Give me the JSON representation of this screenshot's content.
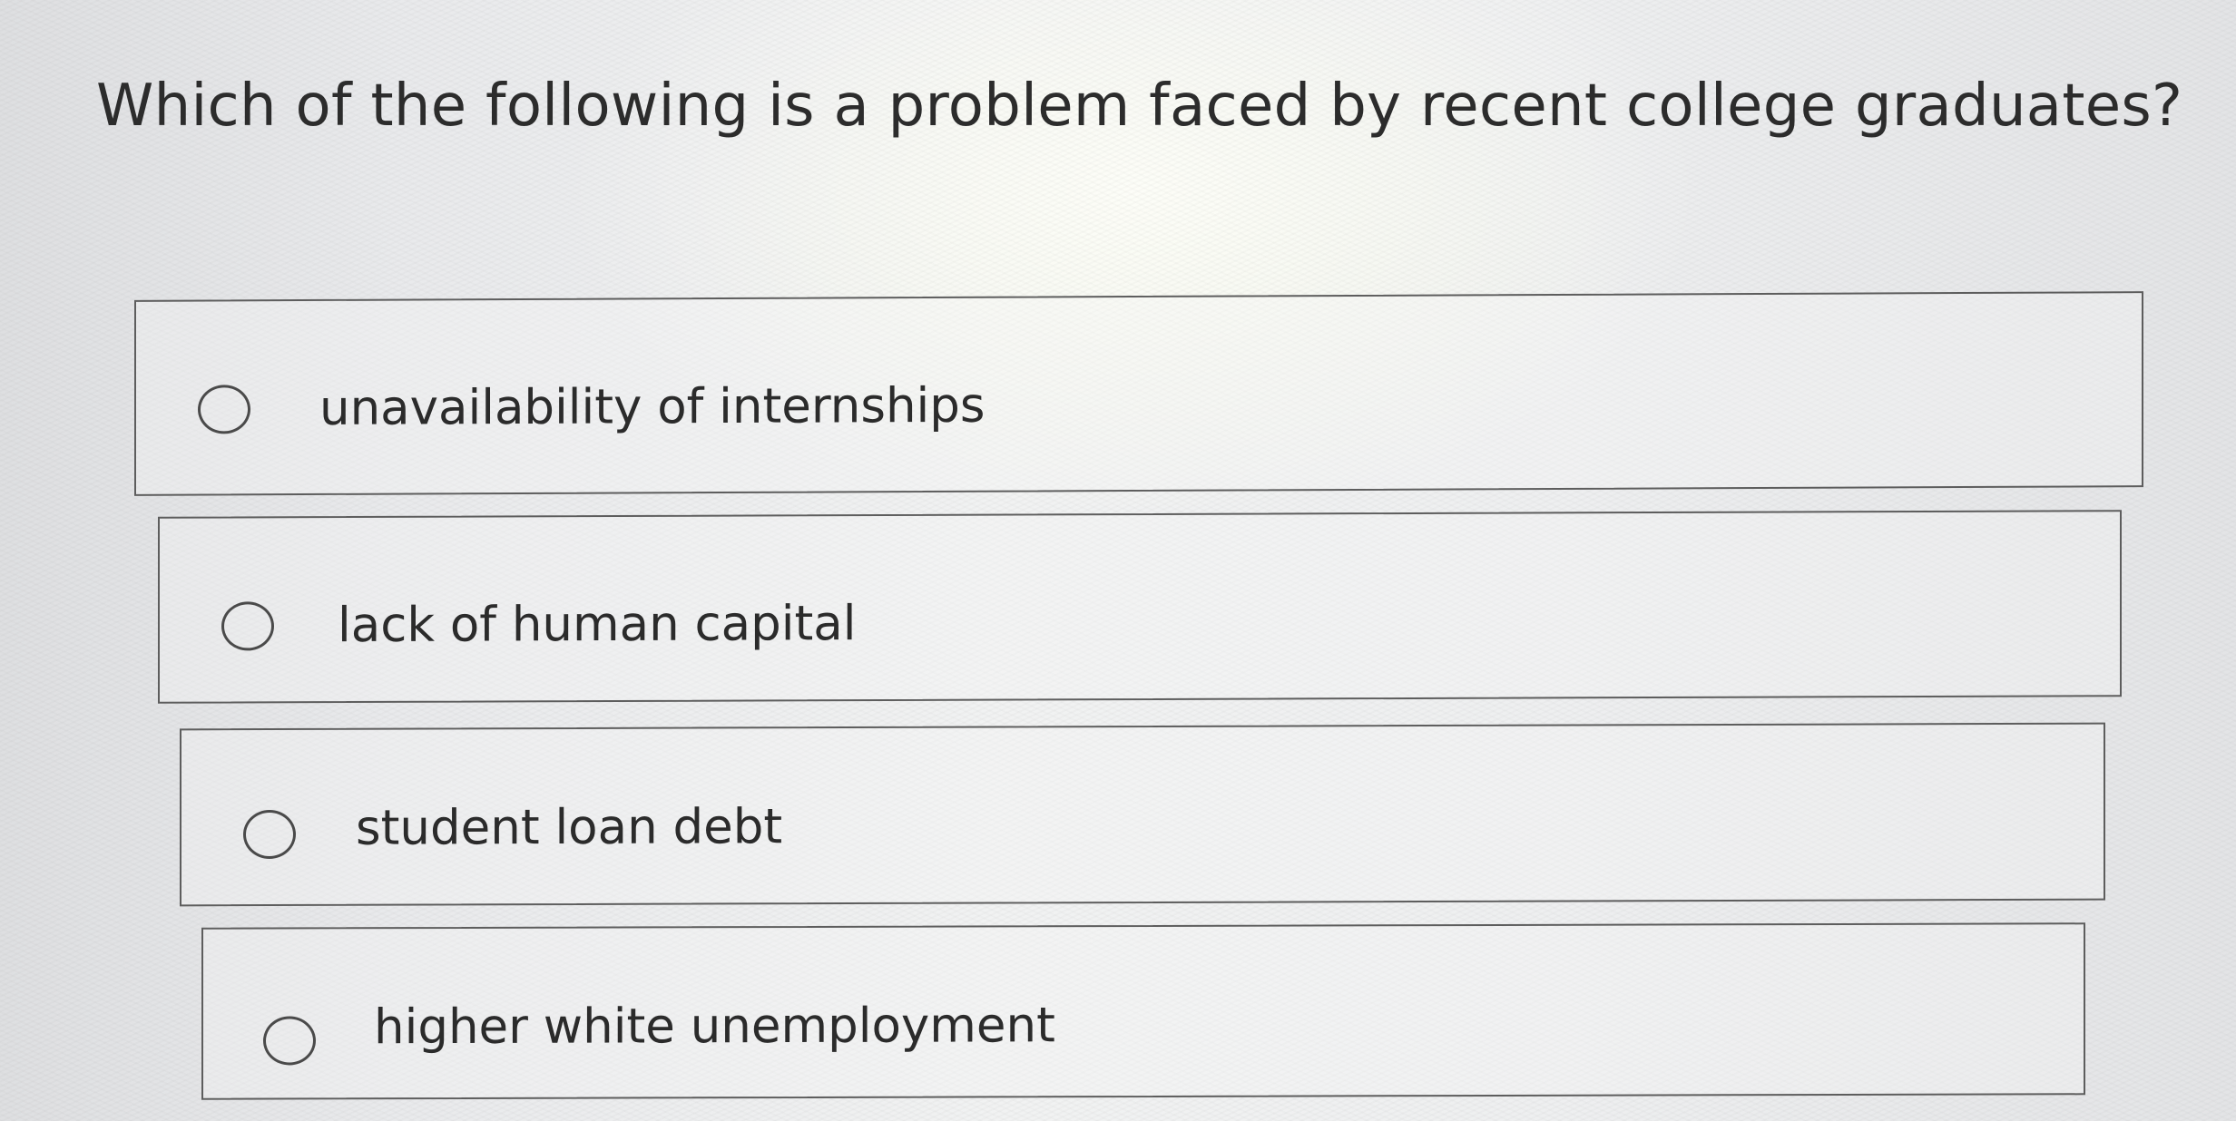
{
  "question": {
    "text": "Which of the following is a problem faced by recent college graduates?"
  },
  "options": [
    {
      "label": "unavailability of internships",
      "selected": false
    },
    {
      "label": "lack of human capital",
      "selected": false
    },
    {
      "label": "student loan debt",
      "selected": false
    },
    {
      "label": "higher white unemployment",
      "selected": false
    }
  ],
  "icons": {
    "radio": "radio-unselected-icon"
  },
  "colors": {
    "text": "#2b2b2b",
    "border": "#5d5d5d",
    "background": "#eeeff0"
  }
}
